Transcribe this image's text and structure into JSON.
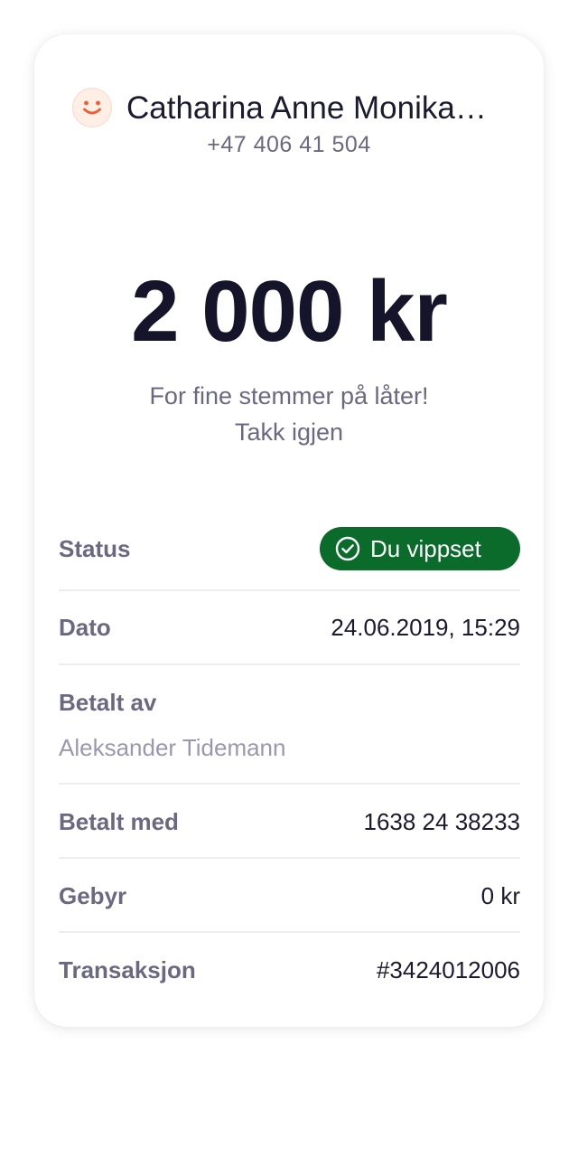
{
  "recipient": {
    "name": "Catharina Anne Monika…",
    "phone": "+47 406 41 504",
    "avatar_icon": "smile-icon",
    "avatar_color": "#f25c2e"
  },
  "payment": {
    "amount": "2 000 kr",
    "message_lines": [
      "For fine stemmer på låter!",
      "Takk igjen"
    ]
  },
  "details": {
    "status": {
      "label": "Status",
      "badge_text": "Du vippset",
      "badge_icon": "check-circle-icon",
      "badge_color": "#0a6b2a"
    },
    "date": {
      "label": "Dato",
      "value": "24.06.2019, 15:29"
    },
    "paid_by": {
      "label": "Betalt av",
      "value": "Aleksander Tidemann"
    },
    "paid_with": {
      "label": "Betalt med",
      "value": "1638 24 38233"
    },
    "fee": {
      "label": "Gebyr",
      "value": "0 kr"
    },
    "transaction": {
      "label": "Transaksjon",
      "value": "#3424012006"
    }
  }
}
